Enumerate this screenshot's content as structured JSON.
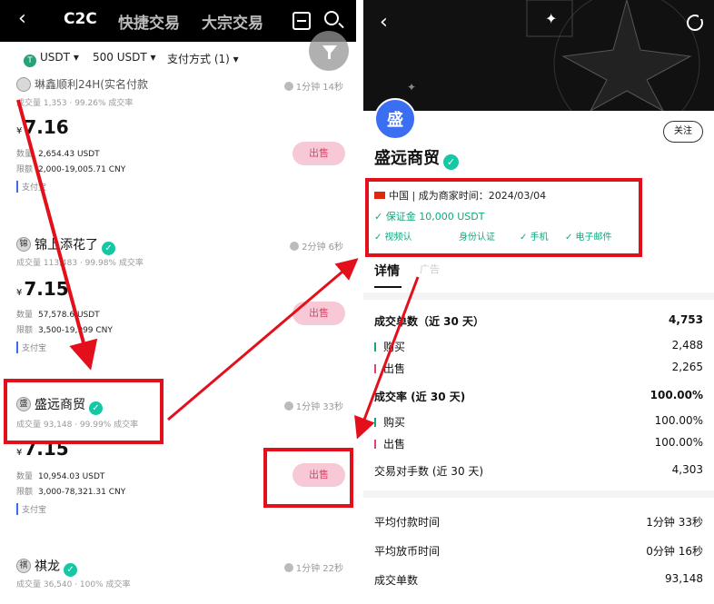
{
  "left": {
    "header": {
      "back_icon": "‹",
      "tabs": [
        "C2C",
        "快捷交易",
        "大宗交易"
      ]
    },
    "filters": {
      "coin": "USDT",
      "amount": "500 USDT",
      "payment": "支付方式 (1)",
      "dropdown_arrow": "▾"
    },
    "merchants": [
      {
        "name": "琳鑫顺利24H(实名付款",
        "stats": "成交量 1,353 · 99.26% 成交率",
        "time": "1分钟 14秒",
        "price": "7.16",
        "qty_label": "数量",
        "qty": "2,654.43 USDT",
        "limit_label": "限额",
        "limit": "2,000-19,005.71 CNY",
        "payment": "支付宝",
        "action": "出售"
      },
      {
        "name": "锦上添花了",
        "stats": "成交量 113,483 · 99.98% 成交率",
        "time": "2分钟 6秒",
        "price": "7.15",
        "qty_label": "数量",
        "qty": "57,578.6 USDT",
        "limit_label": "限额",
        "limit": "3,500-19,999 CNY",
        "payment": "支付宝",
        "action": "出售"
      },
      {
        "name": "盛远商贸",
        "stats": "成交量 93,148 · 99.99% 成交率",
        "time": "1分钟 33秒",
        "price": "7.15",
        "qty_label": "数量",
        "qty": "10,954.03 USDT",
        "limit_label": "限额",
        "limit": "3,000-78,321.31 CNY",
        "payment": "支付宝",
        "action": "出售"
      },
      {
        "name": "祺龙",
        "stats": "成交量 36,540 · 100% 成交率",
        "time": "1分钟 22秒",
        "price": "",
        "qty_label": "",
        "qty": "",
        "limit_label": "",
        "limit": "",
        "payment": "",
        "action": ""
      }
    ],
    "currency_symbol": "¥"
  },
  "right": {
    "back_icon": "‹",
    "avatar_text": "盛",
    "follow_label": "关注",
    "merchant_name": "盛远商贸",
    "since": "中国 | 成为商家时间：2024/03/04",
    "deposit": "✓ 保证金 10,000 USDT",
    "verifications": [
      "✓ 视频认",
      "身份认证",
      "✓ 手机",
      "✓ 电子邮件"
    ],
    "tabs": [
      "详情",
      "广告"
    ],
    "stats": [
      {
        "label": "成交单数（近 30 天）",
        "value": "4,753"
      },
      {
        "label": "购买",
        "value": "2,488"
      },
      {
        "label": "出售",
        "value": "2,265"
      },
      {
        "label": "成交率 (近 30 天)",
        "value": "100.00%"
      },
      {
        "label": "购买",
        "value": "100.00%"
      },
      {
        "label": "出售",
        "value": "100.00%"
      },
      {
        "label": "交易对手数 (近 30 天)",
        "value": "4,303"
      }
    ],
    "stats2": [
      {
        "label": "平均付款时间",
        "value": "1分钟 33秒"
      },
      {
        "label": "平均放币时间",
        "value": "0分钟 16秒"
      },
      {
        "label": "成交单数",
        "value": "93,148"
      }
    ]
  },
  "colors": {
    "highlight_red": "#e3101b",
    "sell_button_bg": "#f7c9d6",
    "sell_button_text": "#e0446c",
    "verify_green": "#16c7a4",
    "avatar_blue": "#3b6ff2"
  }
}
